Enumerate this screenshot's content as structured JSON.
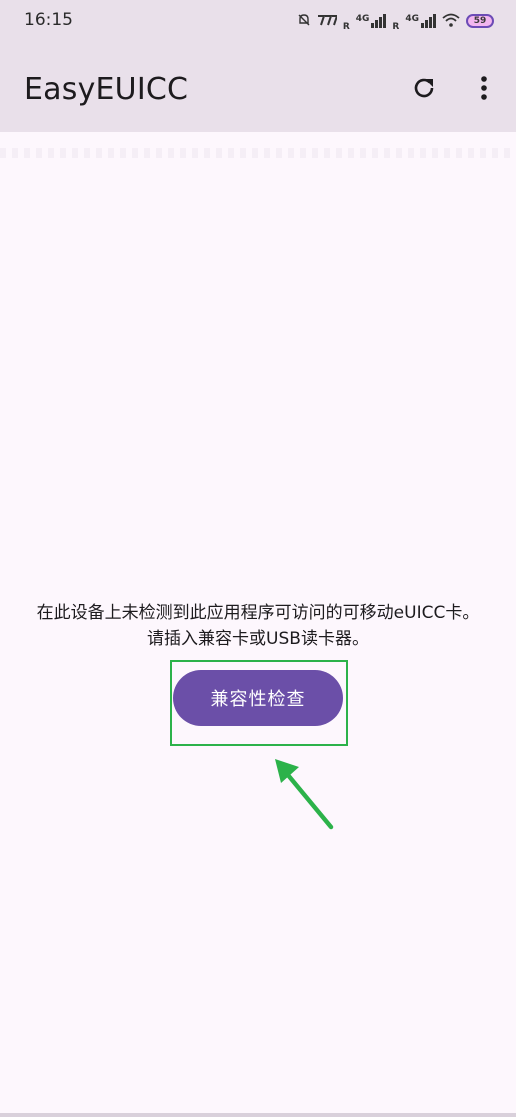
{
  "status_bar": {
    "time": "16:15",
    "network_label_1": "4G",
    "roaming_1": "R",
    "network_label_2": "4G",
    "roaming_2": "R",
    "battery": "59"
  },
  "app_bar": {
    "title": "EasyEUICC"
  },
  "main": {
    "message": "在此设备上未检测到此应用程序可访问的可移动eUICC卡。请插入兼容卡或USB读卡器。",
    "check_button_label": "兼容性检查"
  },
  "colors": {
    "app_bar_bg": "#e9e0ea",
    "page_bg": "#fdf7fd",
    "button_bg": "#6b4fa8",
    "highlight": "#2cb24a"
  }
}
